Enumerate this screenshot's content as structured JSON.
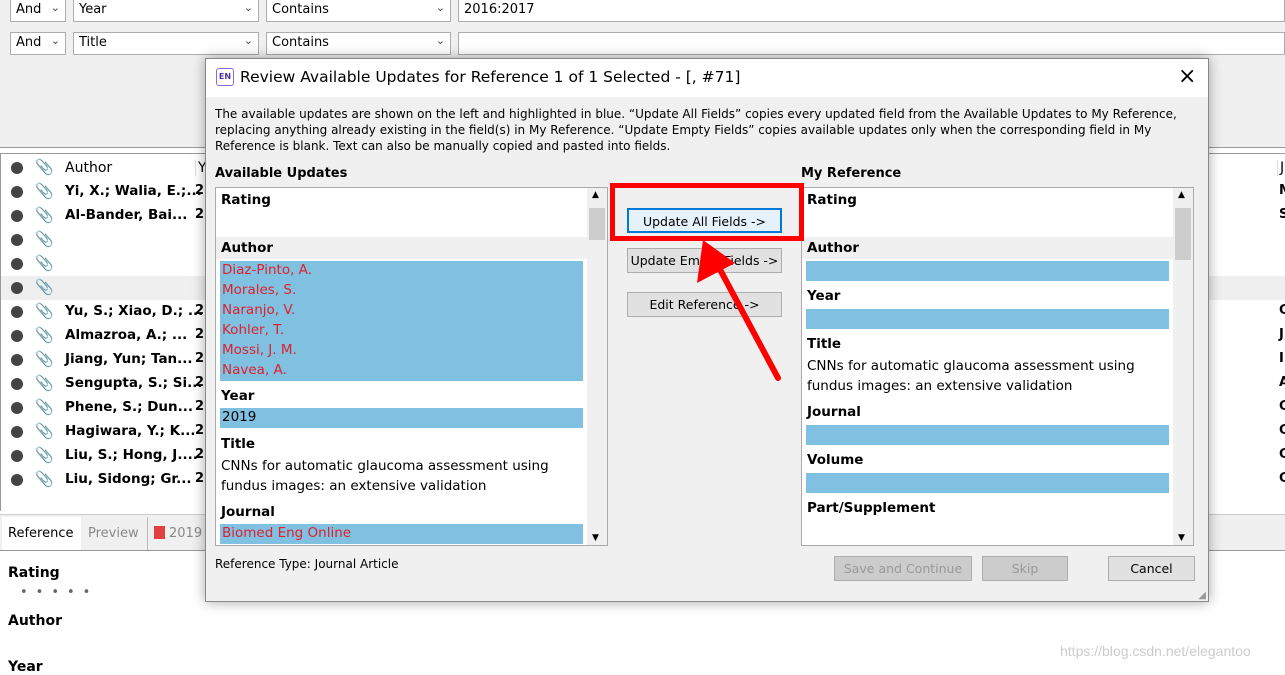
{
  "search": {
    "rows": [
      {
        "bool": "And",
        "field": "Year",
        "op": "Contains",
        "value": "2016:2017"
      },
      {
        "bool": "And",
        "field": "Title",
        "op": "Contains",
        "value": ""
      }
    ]
  },
  "list": {
    "headers": {
      "author": "Author",
      "year": "Ye",
      "journal": "J"
    },
    "rows": [
      {
        "author": "Yi, X.; Walia, E.;...",
        "year": "2",
        "j": "M"
      },
      {
        "author": "Al-Bander, Bai...",
        "year": "2",
        "j": "S"
      },
      {
        "author": "",
        "year": "",
        "j": ""
      },
      {
        "author": "",
        "year": "",
        "j": ""
      },
      {
        "author": "",
        "year": "",
        "j": ""
      },
      {
        "author": "Yu, S.; Xiao, D.; ...",
        "year": "2",
        "j": "C"
      },
      {
        "author": "Almazroa, A.; ...",
        "year": "2",
        "j": "J"
      },
      {
        "author": "Jiang, Yun; Tan...",
        "year": "2",
        "j": "I"
      },
      {
        "author": "Sengupta, S.; Si...",
        "year": "2",
        "j": "A"
      },
      {
        "author": "Phene, S.; Dun...",
        "year": "2",
        "j": "C"
      },
      {
        "author": "Hagiwara, Y.; K...",
        "year": "2",
        "j": "C"
      },
      {
        "author": "Liu, S.; Hong, J....",
        "year": "2",
        "j": "C"
      },
      {
        "author": "Liu, Sidong; Gr...",
        "year": "2",
        "j": "C"
      }
    ]
  },
  "bottom_tabs": {
    "reference": "Reference",
    "preview": "Preview",
    "pdf": "2019"
  },
  "ref_panel": {
    "rating": "Rating",
    "author": "Author",
    "year": "Year"
  },
  "dialog": {
    "icon": "EN",
    "title": "Review Available Updates for Reference 1 of 1 Selected - [,  #71]",
    "description": "The available updates are shown on the left and highlighted in blue. “Update All Fields” copies every updated field from the Available Updates to My Reference, replacing anything already existing in the field(s) in My Reference. “Update Empty Fields” copies available updates only when the corresponding field in My Reference is blank. Text can also be manually copied and pasted into fields.",
    "available_label": "Available Updates",
    "mine_label": "My Reference",
    "available": {
      "rating": "Rating",
      "author": "Author",
      "authors": [
        "Diaz-Pinto, A.",
        "Morales, S.",
        "Naranjo, V.",
        "Kohler, T.",
        "Mossi, J. M.",
        "Navea, A."
      ],
      "year": "Year",
      "year_value": "2019",
      "title": "Title",
      "title_lines": [
        "CNNs for automatic glaucoma assessment using",
        "fundus images: an extensive validation"
      ],
      "journal": "Journal",
      "journal_value": "Biomed Eng Online"
    },
    "mine": {
      "rating": "Rating",
      "author": "Author",
      "year": "Year",
      "title": "Title",
      "title_lines": [
        "CNNs for automatic glaucoma assessment using",
        "fundus images: an extensive validation"
      ],
      "journal": "Journal",
      "volume": "Volume",
      "part": "Part/Supplement"
    },
    "buttons": {
      "update_all": "Update All Fields ->",
      "update_empty": "Update Empty Fields ->",
      "edit": "Edit Reference ->",
      "save": "Save and Continue",
      "skip": "Skip",
      "cancel": "Cancel"
    },
    "reference_type": "Reference Type: Journal Article"
  },
  "watermark": "https://blog.csdn.net/elegantoo",
  "colors": {
    "highlight": "#80c0e0",
    "update_text": "#e0202c",
    "annotation": "#ff0000"
  }
}
